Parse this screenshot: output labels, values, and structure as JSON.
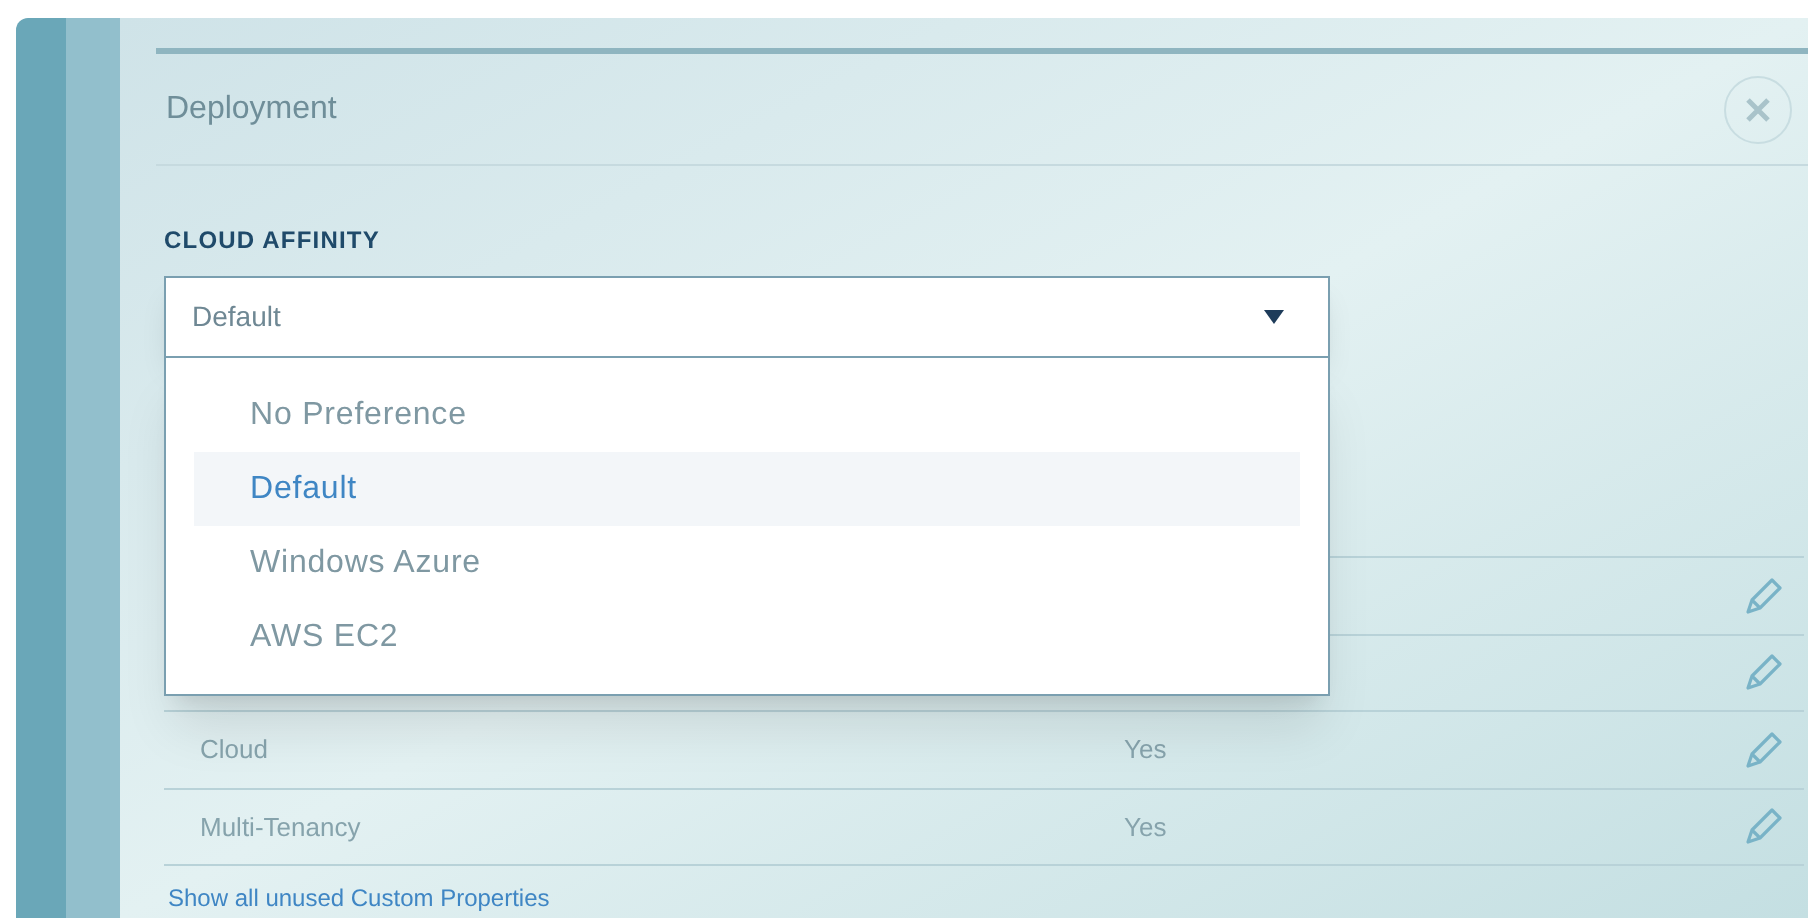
{
  "panel": {
    "title": "Deployment"
  },
  "field": {
    "label": "CLOUD AFFINITY",
    "value": "Default",
    "expanded": true,
    "options": [
      {
        "label": "No Preference",
        "selected": false
      },
      {
        "label": "Default",
        "selected": true
      },
      {
        "label": "Windows Azure",
        "selected": false
      },
      {
        "label": "AWS EC2",
        "selected": false
      }
    ]
  },
  "properties": {
    "rows": [
      {},
      {},
      {
        "name": "Cloud",
        "value": "Yes"
      },
      {
        "name": "Multi-Tenancy",
        "value": "Yes"
      }
    ],
    "link": "Show all unused Custom Properties"
  }
}
